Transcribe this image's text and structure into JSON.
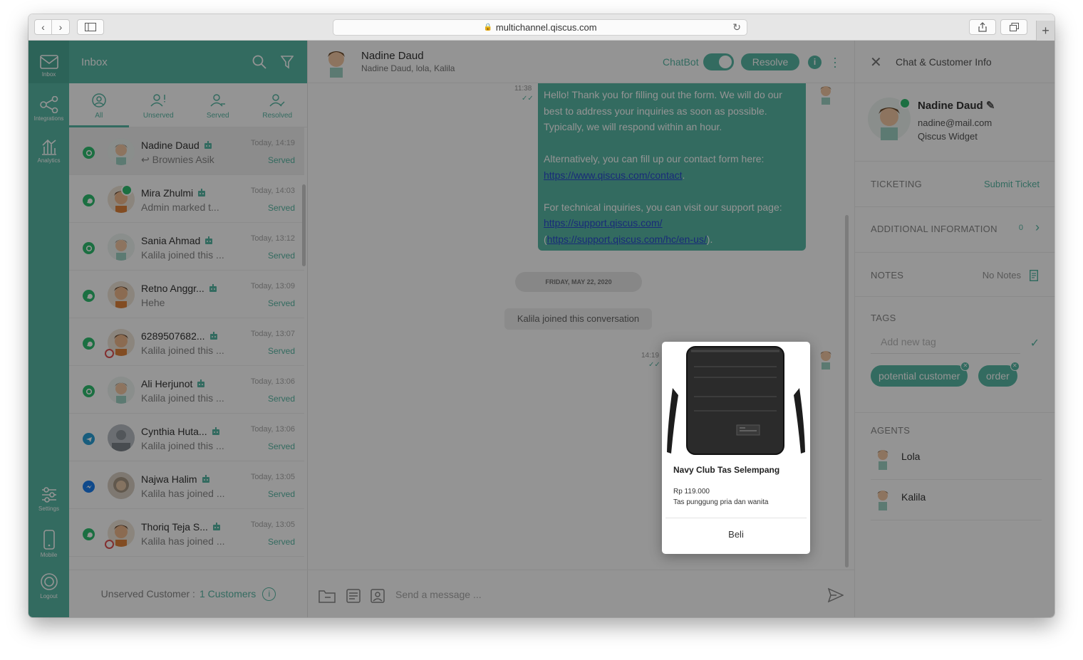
{
  "browser": {
    "url": "multichannel.qiscus.com"
  },
  "rail": {
    "items": [
      {
        "label": "Inbox",
        "icon": "envelope-icon"
      },
      {
        "label": "Integrations",
        "icon": "share-nodes-icon"
      },
      {
        "label": "Analytics",
        "icon": "bar-chart-icon"
      },
      {
        "label": "Settings",
        "icon": "sliders-icon"
      },
      {
        "label": "Mobile",
        "icon": "phone-icon"
      },
      {
        "label": "Logout",
        "icon": "power-icon"
      }
    ]
  },
  "inbox": {
    "title": "Inbox",
    "tabs": [
      {
        "label": "All",
        "icon": "user-circle-icon"
      },
      {
        "label": "Unserved",
        "icon": "user-alert-icon"
      },
      {
        "label": "Served",
        "icon": "user-minus-icon"
      },
      {
        "label": "Resolved",
        "icon": "user-check-icon"
      }
    ],
    "conversations": [
      {
        "name": "Nadine Daud",
        "message": "↩  Brownies Asik",
        "time": "Today, 14:19",
        "status": "Served",
        "channel": "qiscus"
      },
      {
        "name": "Mira Zhulmi",
        "message": "Admin marked t...",
        "time": "Today, 14:03",
        "status": "Served",
        "channel": "whatsapp"
      },
      {
        "name": "Sania Ahmad",
        "message": "Kalila joined this ...",
        "time": "Today, 13:12",
        "status": "Served",
        "channel": "qiscus"
      },
      {
        "name": "Retno Anggr...",
        "message": "Hehe",
        "time": "Today, 13:09",
        "status": "Served",
        "channel": "whatsapp"
      },
      {
        "name": "6289507682...",
        "message": "Kalila joined this ...",
        "time": "Today, 13:07",
        "status": "Served",
        "channel": "whatsapp"
      },
      {
        "name": "Ali Herjunot",
        "message": "Kalila joined this ...",
        "time": "Today, 13:06",
        "status": "Served",
        "channel": "qiscus"
      },
      {
        "name": "Cynthia Huta...",
        "message": "Kalila joined this ...",
        "time": "Today, 13:06",
        "status": "Served",
        "channel": "telegram"
      },
      {
        "name": "Najwa Halim",
        "message": "Kalila has joined ...",
        "time": "Today, 13:05",
        "status": "Served",
        "channel": "messenger"
      },
      {
        "name": "Thoriq Teja S...",
        "message": "Kalila has joined ...",
        "time": "Today, 13:05",
        "status": "Served",
        "channel": "whatsapp"
      }
    ],
    "footer": {
      "label": "Unserved Customer :",
      "count": "1 Customers",
      "info": "i"
    }
  },
  "chat": {
    "name": "Nadine Daud",
    "participants": "Nadine Daud, lola, Kalila",
    "chatbot_label": "ChatBot",
    "chatbot_on": true,
    "resolve_label": "Resolve",
    "info": "i",
    "message_time": "11:38",
    "message": {
      "line1": "Hello! Thank you for filling out the form. We will do our",
      "line2": "best to address your inquiries as soon as possible.",
      "line3": "Typically, we will respond within an hour.",
      "line4": "Alternatively, you can fill up our contact form here:",
      "link1": "https://www.qiscus.com/contact",
      "line5": "For technical inquiries, you can visit our support page:",
      "link2": "https://support.qiscus.com/",
      "link3": "https://support.qiscus.com/hc/en-us/"
    },
    "date_divider": "FRIDAY, MAY 22, 2020",
    "system_message": "Kalila joined this conversation",
    "second_time": "14:19",
    "composer_placeholder": "Send a message ..."
  },
  "panel": {
    "title": "Chat & Customer Info",
    "customer_name": "Nadine Daud",
    "customer_email": "nadine@mail.com",
    "customer_source": "Qiscus Widget",
    "ticketing_label": "TICKETING",
    "submit_ticket": "Submit Ticket",
    "additional_label": "ADDITIONAL INFORMATION",
    "additional_count": "0",
    "notes_label": "NOTES",
    "notes_value": "No Notes",
    "tags_label": "TAGS",
    "tag_placeholder": "Add new tag",
    "tags": [
      "potential customer",
      "order"
    ],
    "agents_label": "AGENTS",
    "agents": [
      "Lola",
      "Kalila"
    ]
  },
  "product_card": {
    "name": "Navy Club Tas Selempang",
    "price": "Rp 119.000",
    "description": "Tas punggung pria dan wanita",
    "button": "Beli"
  },
  "colors": {
    "accent": "#59b8a5",
    "whatsapp": "#2fbf71",
    "telegram": "#2aa0d8",
    "messenger": "#1a7ff0"
  }
}
